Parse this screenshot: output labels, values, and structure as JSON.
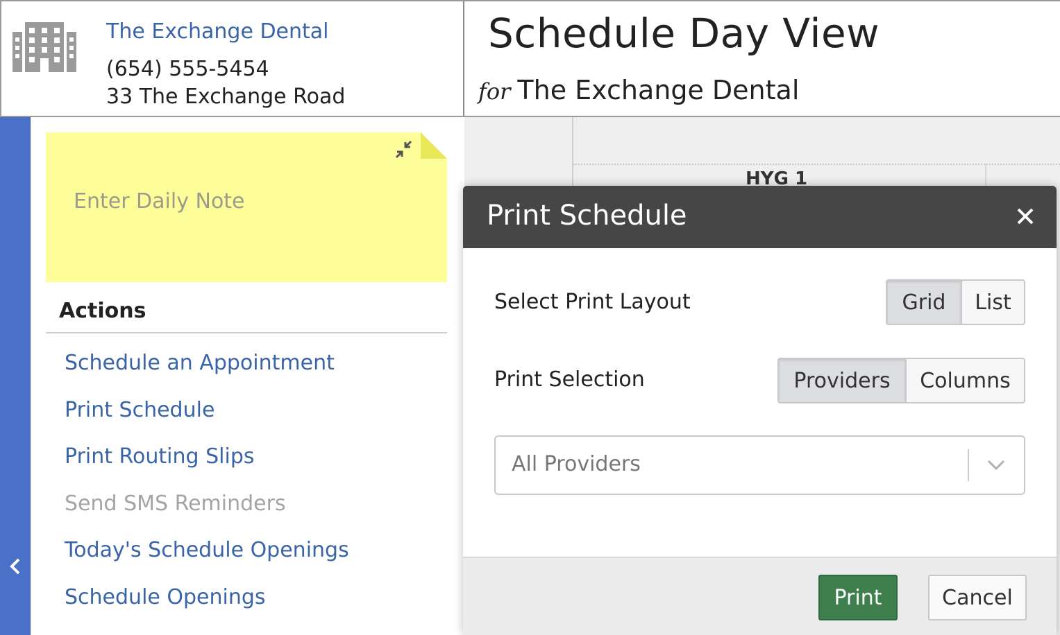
{
  "office": {
    "name": "The Exchange Dental",
    "phone": "(654) 555-5454",
    "address": "33 The Exchange Road",
    "icon": "building-icon"
  },
  "page": {
    "title": "Schedule Day View",
    "subtitle_prefix": "for",
    "subtitle": "The Exchange Dental"
  },
  "daily_note": {
    "placeholder": "Enter Daily Note",
    "collapse_icon": "compress-icon"
  },
  "actions": {
    "heading": "Actions",
    "items": [
      {
        "label": "Schedule an Appointment",
        "enabled": true
      },
      {
        "label": "Print Schedule",
        "enabled": true
      },
      {
        "label": "Print Routing Slips",
        "enabled": true
      },
      {
        "label": "Send SMS Reminders",
        "enabled": false
      },
      {
        "label": "Today's Schedule Openings",
        "enabled": true
      },
      {
        "label": "Schedule Openings",
        "enabled": true
      }
    ]
  },
  "sidebar_toggle": {
    "icon": "chevron-left-icon",
    "glyph": "‹"
  },
  "schedule_grid": {
    "column_header": "HYG 1"
  },
  "print_dialog": {
    "title": "Print Schedule",
    "close_glyph": "✕",
    "layout_label": "Select Print Layout",
    "layout_options": [
      "Grid",
      "List"
    ],
    "layout_selected": "Grid",
    "selection_label": "Print Selection",
    "selection_options": [
      "Providers",
      "Columns"
    ],
    "selection_selected": "Providers",
    "provider_select_value": "All Providers",
    "print_button": "Print",
    "cancel_button": "Cancel"
  },
  "colors": {
    "link": "#3a64a8",
    "rail": "#4a71c7",
    "sticky_note": "#fdfd9a",
    "dialog_header": "#464646",
    "print_button": "#3f7f4e"
  }
}
